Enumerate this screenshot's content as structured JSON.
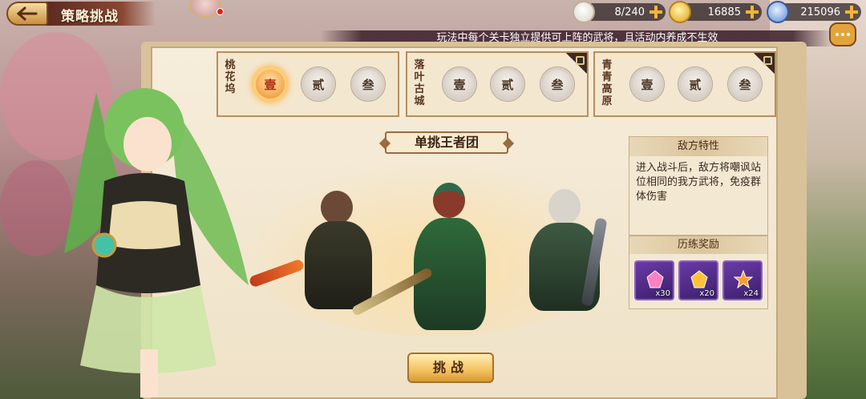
{
  "header": {
    "title": "策略挑战",
    "resources": [
      {
        "icon": "stamina-bun-icon",
        "value": "8/240"
      },
      {
        "icon": "gold-ingot-icon",
        "value": "16885"
      },
      {
        "icon": "silver-coin-icon",
        "value": "215096"
      }
    ]
  },
  "notice": "玩法中每个关卡独立提供可上阵的武将，且活动内养成不生效",
  "stages": [
    {
      "name": "桃花坞",
      "locked": false,
      "levels": [
        "壹",
        "贰",
        "叁"
      ],
      "active_level": 0
    },
    {
      "name": "落叶古城",
      "locked": true,
      "levels": [
        "壹",
        "贰",
        "叁"
      ]
    },
    {
      "name": "青青高原",
      "locked": true,
      "levels": [
        "壹",
        "贰",
        "叁"
      ]
    }
  ],
  "battle": {
    "title": "单挑王者团",
    "traits_title": "敌方特性",
    "traits_text": "进入战斗后，敌方将嘲讽站位相同的我方武将，免疫群体伤害",
    "reward_title": "历练奖励",
    "rewards": [
      {
        "icon": "pink-gem-icon",
        "count": "x30"
      },
      {
        "icon": "gold-gem-icon",
        "count": "x20"
      },
      {
        "icon": "star-shard-icon",
        "count": "x24"
      }
    ],
    "challenge_label": "挑战"
  },
  "colors": {
    "accent": "#f08a2a",
    "button": "#f2c25e",
    "panel": "#f6eddb"
  }
}
